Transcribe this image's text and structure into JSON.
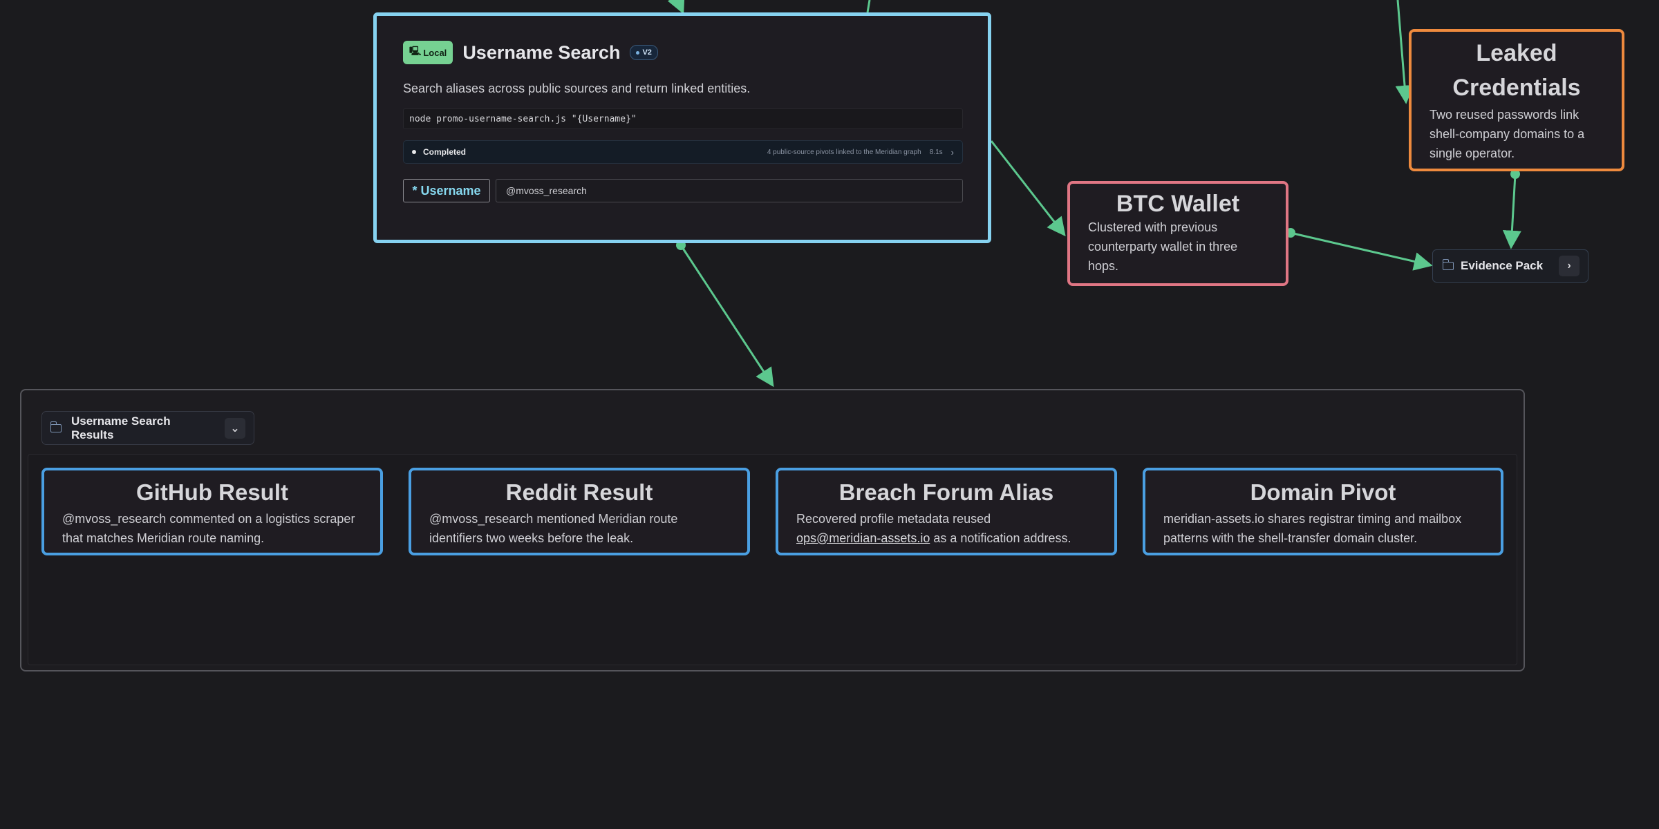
{
  "tool_node": {
    "badge_local": "Local",
    "title": "Username Search",
    "version": "V2",
    "description": "Search aliases across public sources and return linked entities.",
    "command": "node promo-username-search.js \"{Username}\"",
    "status": {
      "label": "Completed",
      "summary": "4 public-source pivots linked to the Meridian graph",
      "duration": "8.1s"
    },
    "param": {
      "label": "* Username",
      "value": "@mvoss_research"
    }
  },
  "btc_node": {
    "title": "BTC Wallet",
    "text": "Clustered with previous counterparty wallet in three hops."
  },
  "leak_node": {
    "title": "Leaked Credentials",
    "text": "Two reused passwords link shell-company domains to a single operator."
  },
  "evidence_pack": {
    "label": "Evidence Pack"
  },
  "group": {
    "label": "Username Search Results",
    "cards": [
      {
        "title": "GitHub Result",
        "text": "@mvoss_research commented on a logistics scraper that matches Meridian route naming."
      },
      {
        "title": "Reddit Result",
        "text": "@mvoss_research mentioned Meridian route identifiers two weeks before the leak."
      },
      {
        "title": "Breach Forum Alias",
        "text_before": "Recovered profile metadata reused",
        "link": "ops@meridian-assets.io",
        "text_after": "as a notification address."
      },
      {
        "title": "Domain Pivot",
        "text": "meridian-assets.io shares registrar timing and mailbox patterns with the shell-transfer domain cluster."
      }
    ]
  },
  "colors": {
    "edge": "#5cc88e",
    "tool_border": "#86d2f0",
    "btc_border": "#e07684",
    "leak_border": "#ee8a3e",
    "result_border": "#4a9fe2"
  }
}
